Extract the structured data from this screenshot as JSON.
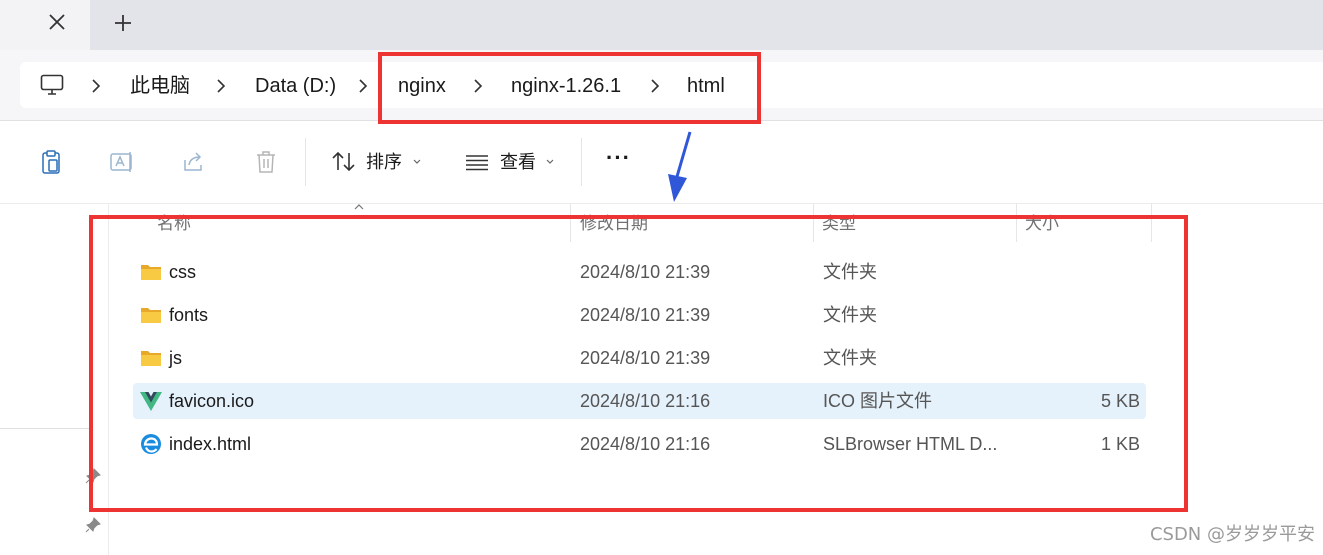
{
  "tabbar": {
    "close_icon": "close-icon",
    "new_tab_icon": "plus-icon"
  },
  "breadcrumb": {
    "root_icon": "computer-icon",
    "items": [
      "此电脑",
      "Data (D:)",
      "nginx",
      "nginx-1.26.1",
      "html"
    ]
  },
  "toolbar": {
    "icons": [
      "clipboard-icon",
      "rename-icon",
      "share-icon",
      "delete-icon"
    ],
    "sort_label": "排序",
    "view_label": "查看",
    "more_label": "···"
  },
  "columns": {
    "name": "名称",
    "date": "修改日期",
    "type": "类型",
    "size": "大小"
  },
  "files": [
    {
      "name": "css",
      "date": "2024/8/10 21:39",
      "type": "文件夹",
      "size": "",
      "icon": "folder-icon"
    },
    {
      "name": "fonts",
      "date": "2024/8/10 21:39",
      "type": "文件夹",
      "size": "",
      "icon": "folder-icon"
    },
    {
      "name": "js",
      "date": "2024/8/10 21:39",
      "type": "文件夹",
      "size": "",
      "icon": "folder-icon"
    },
    {
      "name": "favicon.ico",
      "date": "2024/8/10 21:16",
      "type": "ICO 图片文件",
      "size": "5 KB",
      "icon": "vue-logo-icon"
    },
    {
      "name": "index.html",
      "date": "2024/8/10 21:16",
      "type": "SLBrowser HTML D...",
      "size": "1 KB",
      "icon": "browser-icon"
    }
  ],
  "watermark": "CSDN @岁岁岁平安",
  "colors": {
    "highlight": "#ee3333",
    "selected_row": "#e5f1fb",
    "arrow": "#2f57d8",
    "folder": "#f5c33b"
  }
}
